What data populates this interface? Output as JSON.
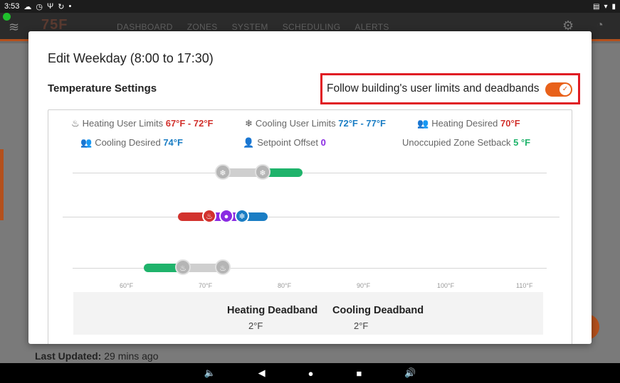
{
  "status_bar": {
    "time": "3:53",
    "left_icons": [
      "cloud-icon",
      "clock-icon",
      "usb-icon",
      "sync-icon",
      "dot-icon"
    ],
    "right_icons": [
      "sim-icon",
      "wifi-icon",
      "battery-icon"
    ]
  },
  "app": {
    "logo": "75F",
    "nav": [
      "DASHBOARD",
      "ZONES",
      "SYSTEM",
      "SCHEDULING",
      "ALERTS"
    ]
  },
  "background": {
    "last_updated_label": "Last Updated:",
    "last_updated_value": "29 mins ago"
  },
  "modal": {
    "title": "Edit Weekday (8:00 to 17:30)",
    "section_title": "Temperature Settings",
    "follow_label": "Follow building's user limits and deadbands",
    "follow_enabled": true,
    "legend": {
      "heating_limits_label": "Heating User Limits",
      "heating_limits_value": "67°F - 72°F",
      "cooling_limits_label": "Cooling User Limits",
      "cooling_limits_value": "72°F - 77°F",
      "heating_desired_label": "Heating Desired",
      "heating_desired_value": "70°F",
      "cooling_desired_label": "Cooling Desired",
      "cooling_desired_value": "74°F",
      "setpoint_offset_label": "Setpoint Offset",
      "setpoint_offset_value": "0",
      "unoccupied_setback_label": "Unoccupied Zone Setback",
      "unoccupied_setback_value": "5 °F"
    },
    "scale_ticks": [
      "60°F",
      "70°F",
      "80°F",
      "90°F",
      "100°F",
      "110°F"
    ],
    "deadbands": {
      "heating_label": "Heating Deadband",
      "heating_value": "2°F",
      "cooling_label": "Cooling Deadband",
      "cooling_value": "2°F"
    }
  },
  "colors": {
    "accent": "#e8611a",
    "heating": "#d2322d",
    "cooling": "#1a7dc4",
    "offset": "#8a2be2",
    "limit_ok": "#1fb36b",
    "highlight": "#e01b24"
  }
}
